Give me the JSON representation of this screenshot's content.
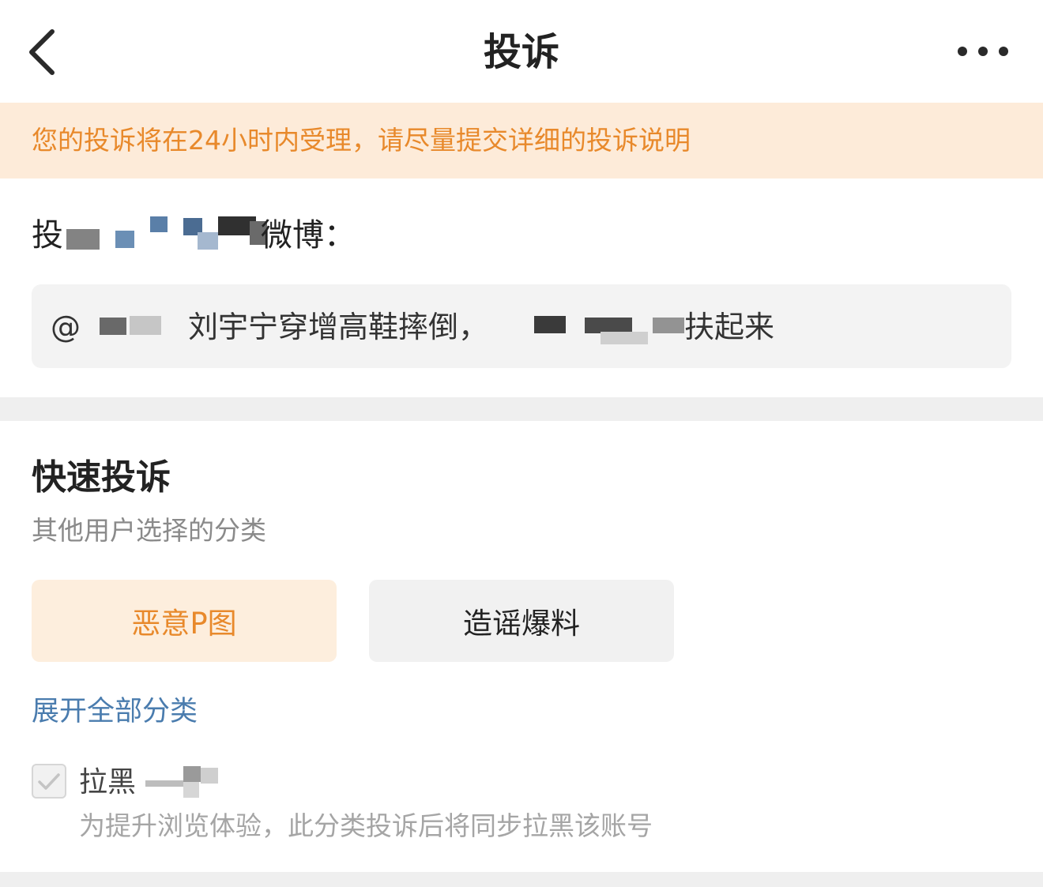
{
  "nav": {
    "title": "投诉",
    "back_icon": "chevron-left-icon",
    "more_icon": "more-horizontal-icon"
  },
  "notice": {
    "text": "您的投诉将在24小时内受理，请尽量提交详细的投诉说明"
  },
  "target": {
    "label_prefix": "投",
    "label_suffix": "微博："
  },
  "preview": {
    "prefix": "@",
    "text_main": "刘宇宁穿增高鞋摔倒，",
    "text_tail": "扶起来"
  },
  "quick_complaint": {
    "title": "快速投诉",
    "subtitle": "其他用户选择的分类",
    "categories": [
      {
        "label": "恶意P图",
        "selected": true
      },
      {
        "label": "造谣爆料",
        "selected": false
      }
    ],
    "expand_label": "展开全部分类"
  },
  "block": {
    "label": "拉黑",
    "checked": true,
    "description": "为提升浏览体验，此分类投诉后将同步拉黑该账号"
  },
  "colors": {
    "accent_orange": "#e8892b",
    "notice_bg": "#fdebd9",
    "link_blue": "#4a7cae"
  }
}
